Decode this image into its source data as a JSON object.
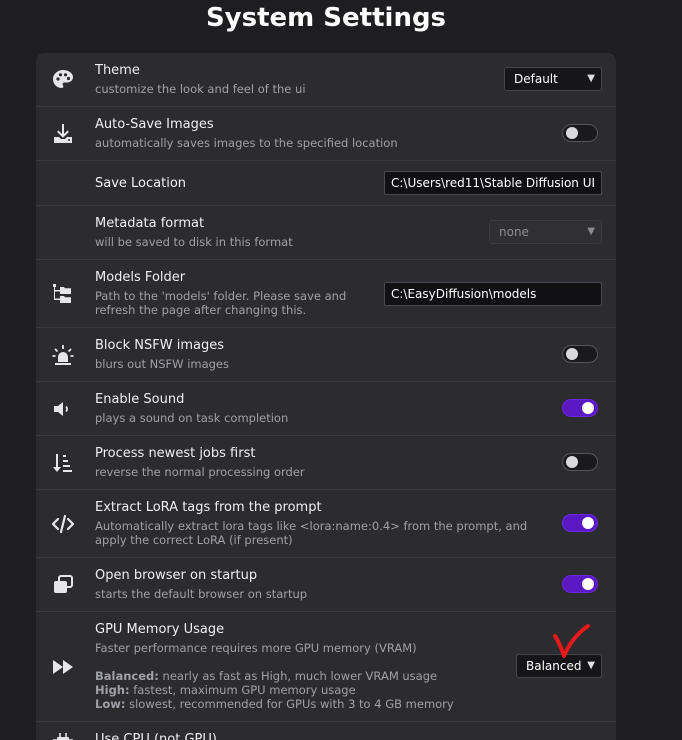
{
  "page_title": "System Settings",
  "settings": {
    "theme": {
      "label": "Theme",
      "desc": "customize the look and feel of the ui",
      "value": "Default",
      "icon": "palette-icon"
    },
    "autosave": {
      "label": "Auto-Save Images",
      "desc": "automatically saves images to the specified location",
      "enabled": false,
      "icon": "download-icon"
    },
    "save_location": {
      "label": "Save Location",
      "value": "C:\\Users\\red11\\Stable Diffusion UI"
    },
    "metadata": {
      "label": "Metadata format",
      "desc": "will be saved to disk in this format",
      "value": "none"
    },
    "models_folder": {
      "label": "Models Folder",
      "desc": "Path to the 'models' folder. Please save and refresh the page after changing this.",
      "value": "C:\\EasyDiffusion\\models",
      "icon": "folder-tree-icon"
    },
    "nsfw": {
      "label": "Block NSFW images",
      "desc": "blurs out NSFW images",
      "enabled": false,
      "icon": "siren-icon"
    },
    "sound": {
      "label": "Enable Sound",
      "desc": "plays a sound on task completion",
      "enabled": true,
      "icon": "volume-icon"
    },
    "newest_first": {
      "label": "Process newest jobs first",
      "desc": "reverse the normal processing order",
      "enabled": false,
      "icon": "sort-down-icon"
    },
    "lora": {
      "label": "Extract LoRA tags from the prompt",
      "desc": "Automatically extract lora tags like <lora:name:0.4> from the prompt, and apply the correct LoRA (if present)",
      "enabled": true,
      "icon": "code-icon"
    },
    "browser": {
      "label": "Open browser on startup",
      "desc": "starts the default browser on startup",
      "enabled": true,
      "icon": "window-restore-icon"
    },
    "gpu_memory": {
      "label": "GPU Memory Usage",
      "desc": "Faster performance requires more GPU memory (VRAM)",
      "value": "Balanced",
      "icon": "fast-forward-icon",
      "balanced_title": "Balanced:",
      "balanced_text": "nearly as fast as High, much lower VRAM usage",
      "high_title": "High:",
      "high_text": "fastest, maximum GPU memory usage",
      "low_title": "Low:",
      "low_text": "slowest, recommended for GPUs with 3 to 4 GB memory"
    },
    "use_cpu": {
      "label": "Use CPU (not GPU)",
      "icon": "microchip-icon"
    }
  },
  "colors": {
    "accent": "#5a18c2",
    "annotation": "#e8191a"
  }
}
